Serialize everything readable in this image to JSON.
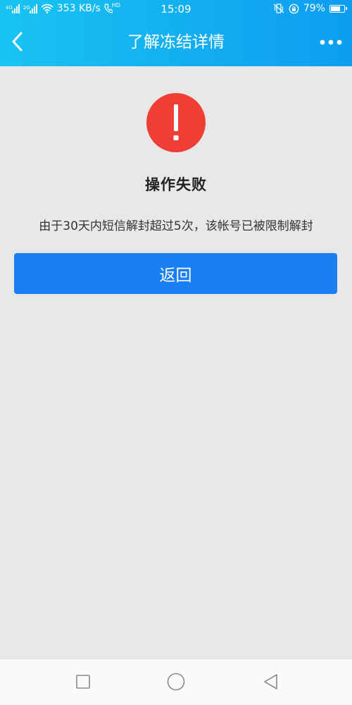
{
  "status_bar": {
    "left_network_tag_1": "4G",
    "left_network_tag_2": "2G",
    "speed": "353 KB/s",
    "hd_tag": "HD",
    "time": "15:09",
    "battery": "79%",
    "battery_level": 0.79
  },
  "nav_bar": {
    "title": "了解冻结详情",
    "back_icon": "chevron-left-icon",
    "more_icon": "more-dots-icon"
  },
  "result": {
    "icon": "exclamation-circle-icon",
    "title": "操作失败",
    "description": "由于30天内短信解封超过5次，该帐号已被限制解封",
    "return_button_label": "返回"
  },
  "system_nav": {
    "recent_icon": "square-icon",
    "home_icon": "circle-icon",
    "back_icon": "triangle-back-icon"
  },
  "colors": {
    "header_start": "#19c4f2",
    "header_end": "#0e9df0",
    "background": "#e8e8e8",
    "error_red": "#ef3e36",
    "button_blue": "#1a7ef5"
  }
}
